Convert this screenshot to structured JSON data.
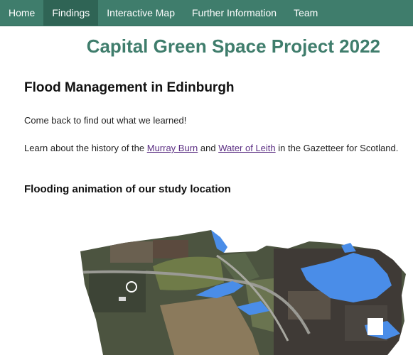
{
  "nav": {
    "items": [
      {
        "label": "Home",
        "active": false
      },
      {
        "label": "Findings",
        "active": true
      },
      {
        "label": "Interactive Map",
        "active": false
      },
      {
        "label": "Further Information",
        "active": false
      },
      {
        "label": "Team",
        "active": false
      }
    ],
    "color": "#3f7d6c",
    "active_color": "#2f6455"
  },
  "site_title": "Capital Green Space Project 2022",
  "page": {
    "heading": "Flood Management in Edinburgh",
    "paragraph1": "Come back to find out what we learned!",
    "paragraph2": {
      "prefix": "Learn about the history of the ",
      "link1": "Murray Burn",
      "middle": " and ",
      "link2": "Water of Leith",
      "suffix": " in the Gazetteer for Scotland."
    },
    "subheading": "Flooding animation of our study location"
  },
  "colors": {
    "title": "#3f7d6c",
    "link": "#5a2d82",
    "flood": "#4a8de8"
  }
}
